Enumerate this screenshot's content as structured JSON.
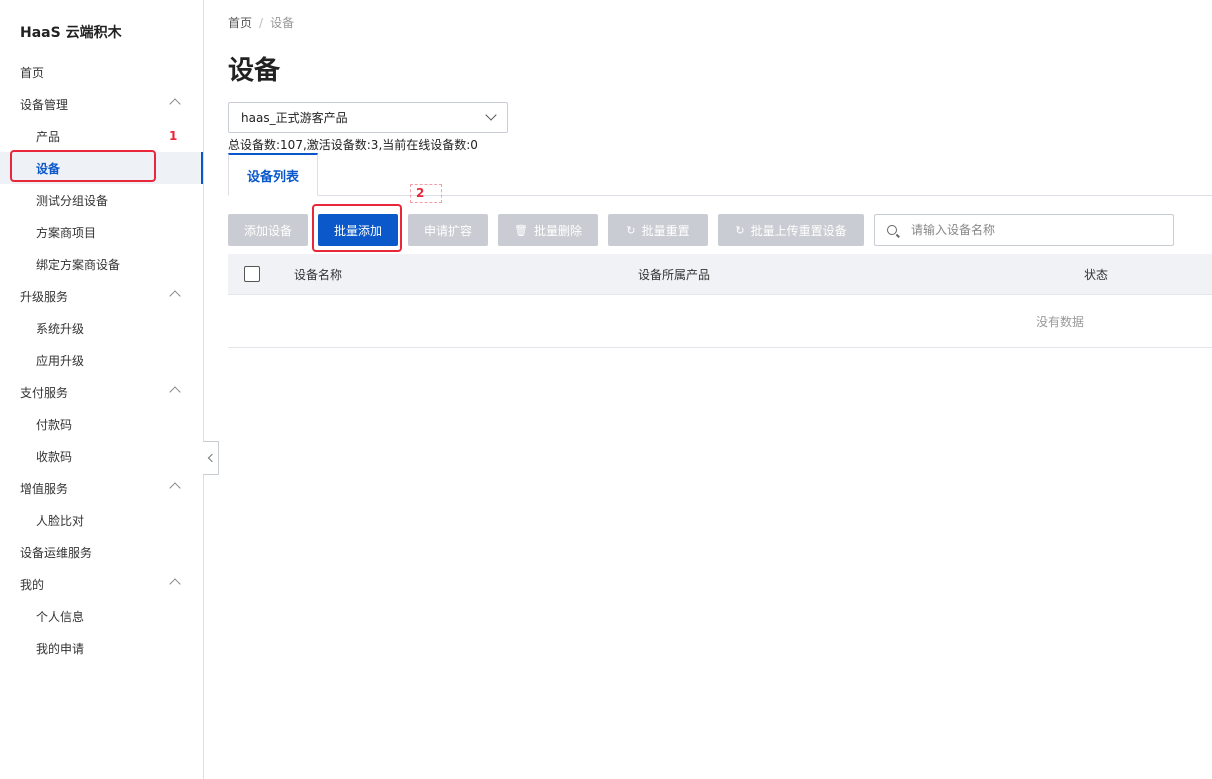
{
  "brand": "HaaS 云端积木",
  "sidebar": {
    "items": [
      {
        "label": "首页",
        "level": 1
      },
      {
        "label": "设备管理",
        "level": 1,
        "expandable": true
      },
      {
        "label": "产品",
        "level": 2
      },
      {
        "label": "设备",
        "level": 2,
        "active": true
      },
      {
        "label": "测试分组设备",
        "level": 2
      },
      {
        "label": "方案商项目",
        "level": 2
      },
      {
        "label": "绑定方案商设备",
        "level": 2
      },
      {
        "label": "升级服务",
        "level": 1,
        "expandable": true
      },
      {
        "label": "系统升级",
        "level": 2
      },
      {
        "label": "应用升级",
        "level": 2
      },
      {
        "label": "支付服务",
        "level": 1,
        "expandable": true
      },
      {
        "label": "付款码",
        "level": 2
      },
      {
        "label": "收款码",
        "level": 2
      },
      {
        "label": "增值服务",
        "level": 1,
        "expandable": true
      },
      {
        "label": "人脸比对",
        "level": 2
      },
      {
        "label": "设备运维服务",
        "level": 1
      },
      {
        "label": "我的",
        "level": 1,
        "expandable": true
      },
      {
        "label": "个人信息",
        "level": 2
      },
      {
        "label": "我的申请",
        "level": 2
      }
    ]
  },
  "annotations": {
    "one": "1",
    "two": "2"
  },
  "breadcrumb": {
    "home": "首页",
    "separator": "/",
    "current": "设备"
  },
  "page": {
    "title": "设备"
  },
  "product_select": {
    "value": "haas_正式游客产品"
  },
  "stats": "总设备数:107,激活设备数:3,当前在线设备数:0",
  "tabs": [
    {
      "label": "设备列表",
      "active": true
    }
  ],
  "toolbar": {
    "add_device": "添加设备",
    "batch_add": "批量添加",
    "apply_expand": "申请扩容",
    "batch_delete": "批量删除",
    "batch_reset": "批量重置",
    "batch_upload_reset": "批量上传重置设备"
  },
  "search": {
    "placeholder": "请输入设备名称"
  },
  "table": {
    "columns": [
      "设备名称",
      "设备所属产品",
      "状态"
    ],
    "empty_text": "没有数据"
  },
  "colors": {
    "primary": "#0a58ca",
    "disabled": "#c9ccd2",
    "annotation": "#e8283a"
  }
}
